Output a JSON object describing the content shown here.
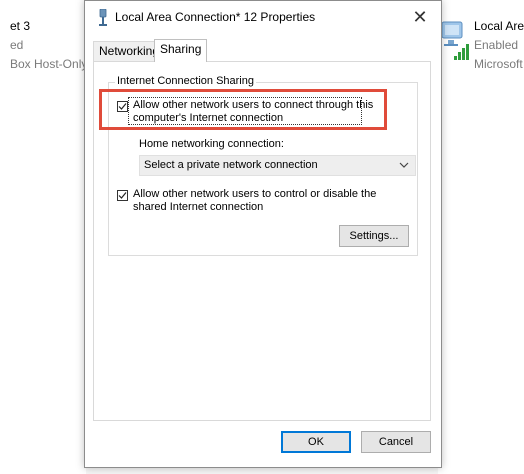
{
  "background": {
    "left_lines": [
      "et 3",
      "ed",
      "Box Host-Only"
    ],
    "right_lines": [
      "Local Area",
      "Enabled",
      "Microsoft"
    ]
  },
  "dialog": {
    "title": "Local Area Connection* 12 Properties",
    "close_glyph": "✕",
    "tabs": [
      {
        "label": "Networking",
        "active": false
      },
      {
        "label": "Sharing",
        "active": true
      }
    ],
    "group": {
      "label": "Internet Connection Sharing",
      "allow_connect": {
        "checked": true,
        "line1": "Allow other network users to connect through this",
        "line2": "computer's Internet connection"
      },
      "home_label": "Home networking connection:",
      "home_select": {
        "value": "Select a private network connection"
      },
      "allow_control": {
        "checked": true,
        "line1": "Allow other network users to control or disable the",
        "line2": "shared Internet connection"
      },
      "settings_label": "Settings..."
    },
    "ok_label": "OK",
    "cancel_label": "Cancel"
  },
  "colors": {
    "highlight": "#e04b3a",
    "accent": "#0078d7"
  }
}
